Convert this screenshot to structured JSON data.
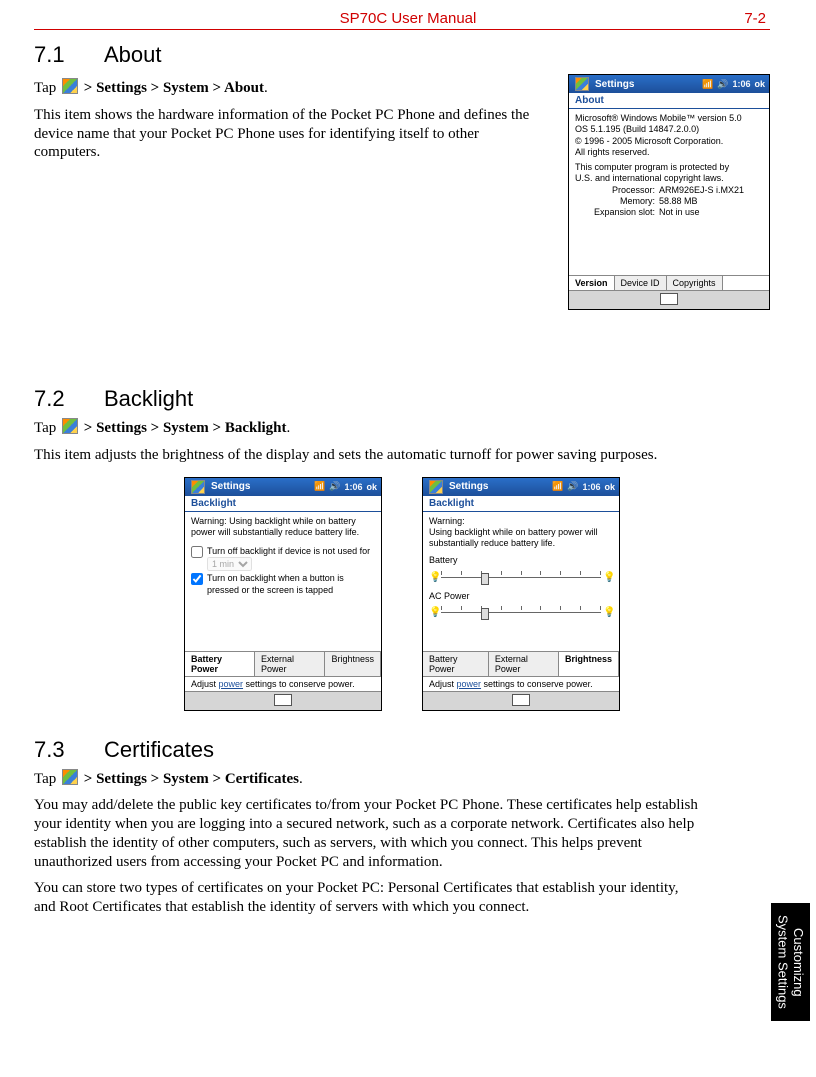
{
  "header": {
    "center": "SP70C User Manual",
    "right": "7-2"
  },
  "side_tab": {
    "line1": "Customizng",
    "line2": "System Settings"
  },
  "s71": {
    "num": "7.1",
    "title": "About",
    "tap_prefix": "Tap ",
    "tap_path": " > Settings > System > About",
    "para": "This item shows the hardware information of the Pocket PC Phone and defines the device name that your Pocket PC Phone uses for identifying itself to other computers."
  },
  "about_shot": {
    "titlebar": "Settings",
    "status": "1:06",
    "ok": "ok",
    "subtitle": "About",
    "l1": "Microsoft® Windows Mobile™ version 5.0",
    "l2": "OS 5.1.195 (Build 14847.2.0.0)",
    "l3": "© 1996 - 2005 Microsoft Corporation.",
    "l4": "All rights reserved.",
    "l5": "This computer program is protected by",
    "l6": "U.S. and international copyright laws.",
    "proc_k": "Processor:",
    "proc_v": "ARM926EJ-S i.MX21",
    "mem_k": "Memory:",
    "mem_v": "58.88 MB",
    "exp_k": "Expansion slot:",
    "exp_v": "Not in use",
    "tabs": [
      "Version",
      "Device ID",
      "Copyrights"
    ]
  },
  "s72": {
    "num": "7.2",
    "title": "Backlight",
    "tap_prefix": "Tap ",
    "tap_path": " > Settings > System > Backlight",
    "para": "This item adjusts the brightness of the display and sets the automatic turnoff for power saving purposes."
  },
  "bl1": {
    "titlebar": "Settings",
    "status": "1:06",
    "ok": "ok",
    "subtitle": "Backlight",
    "warn": "Warning: Using backlight while on battery power will substantially reduce battery life.",
    "cb1": "Turn off backlight if device is not used for",
    "dd": "1 min",
    "cb2": "Turn on backlight when a button is pressed or the screen is tapped",
    "tabs": [
      "Battery Power",
      "External Power",
      "Brightness"
    ],
    "footer_pre": "Adjust ",
    "footer_link": "power",
    "footer_post": " settings to conserve power."
  },
  "bl2": {
    "titlebar": "Settings",
    "status": "1:06",
    "ok": "ok",
    "subtitle": "Backlight",
    "warn1": "Warning:",
    "warn2": "Using backlight while on battery power will substantially reduce battery life.",
    "lbl_batt": "Battery",
    "lbl_ac": "AC Power",
    "tabs": [
      "Battery Power",
      "External Power",
      "Brightness"
    ],
    "footer_pre": "Adjust ",
    "footer_link": "power",
    "footer_post": " settings to conserve power."
  },
  "s73": {
    "num": "7.3",
    "title": "Certificates",
    "tap_prefix": "Tap ",
    "tap_path": " > Settings > System > Certificates",
    "p1": "You may add/delete the public key certificates to/from your Pocket PC Phone. These certificates help establish your identity when you are logging into a secured network, such as a corporate network. Certificates also help establish the identity of other computers, such as servers, with which you connect. This helps prevent unauthorized users from accessing your Pocket PC and information.",
    "p2": "You can store two types of certificates on your Pocket PC: Personal Certificates that establish your identity, and Root Certificates that establish the identity of servers with which you connect."
  }
}
